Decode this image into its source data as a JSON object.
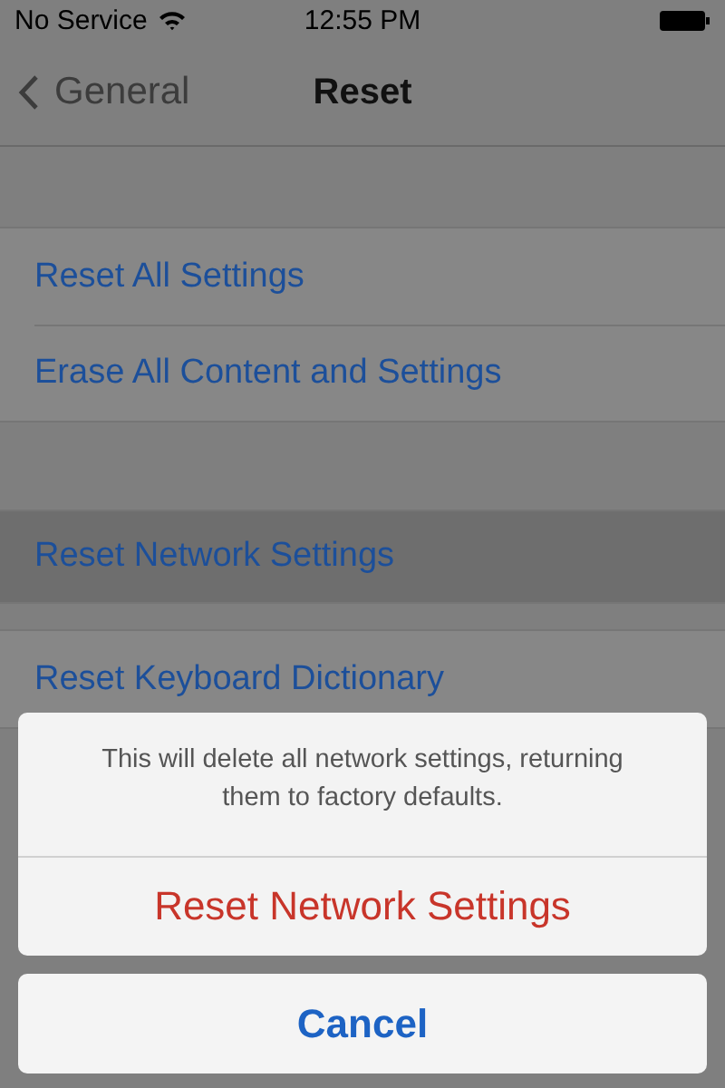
{
  "status_bar": {
    "carrier": "No Service",
    "time": "12:55 PM"
  },
  "nav_bar": {
    "back_label": "General",
    "title": "Reset"
  },
  "groups": [
    [
      {
        "label": "Reset All Settings",
        "selected": false
      },
      {
        "label": "Erase All Content and Settings",
        "selected": false
      }
    ],
    [
      {
        "label": "Reset Network Settings",
        "selected": true
      }
    ],
    [
      {
        "label": "Reset Keyboard Dictionary",
        "selected": false
      }
    ]
  ],
  "action_sheet": {
    "message": "This will delete all network settings, returning them to factory defaults.",
    "actions": [
      {
        "label": "Reset Network Settings",
        "kind": "destructive"
      }
    ],
    "cancel": "Cancel"
  }
}
